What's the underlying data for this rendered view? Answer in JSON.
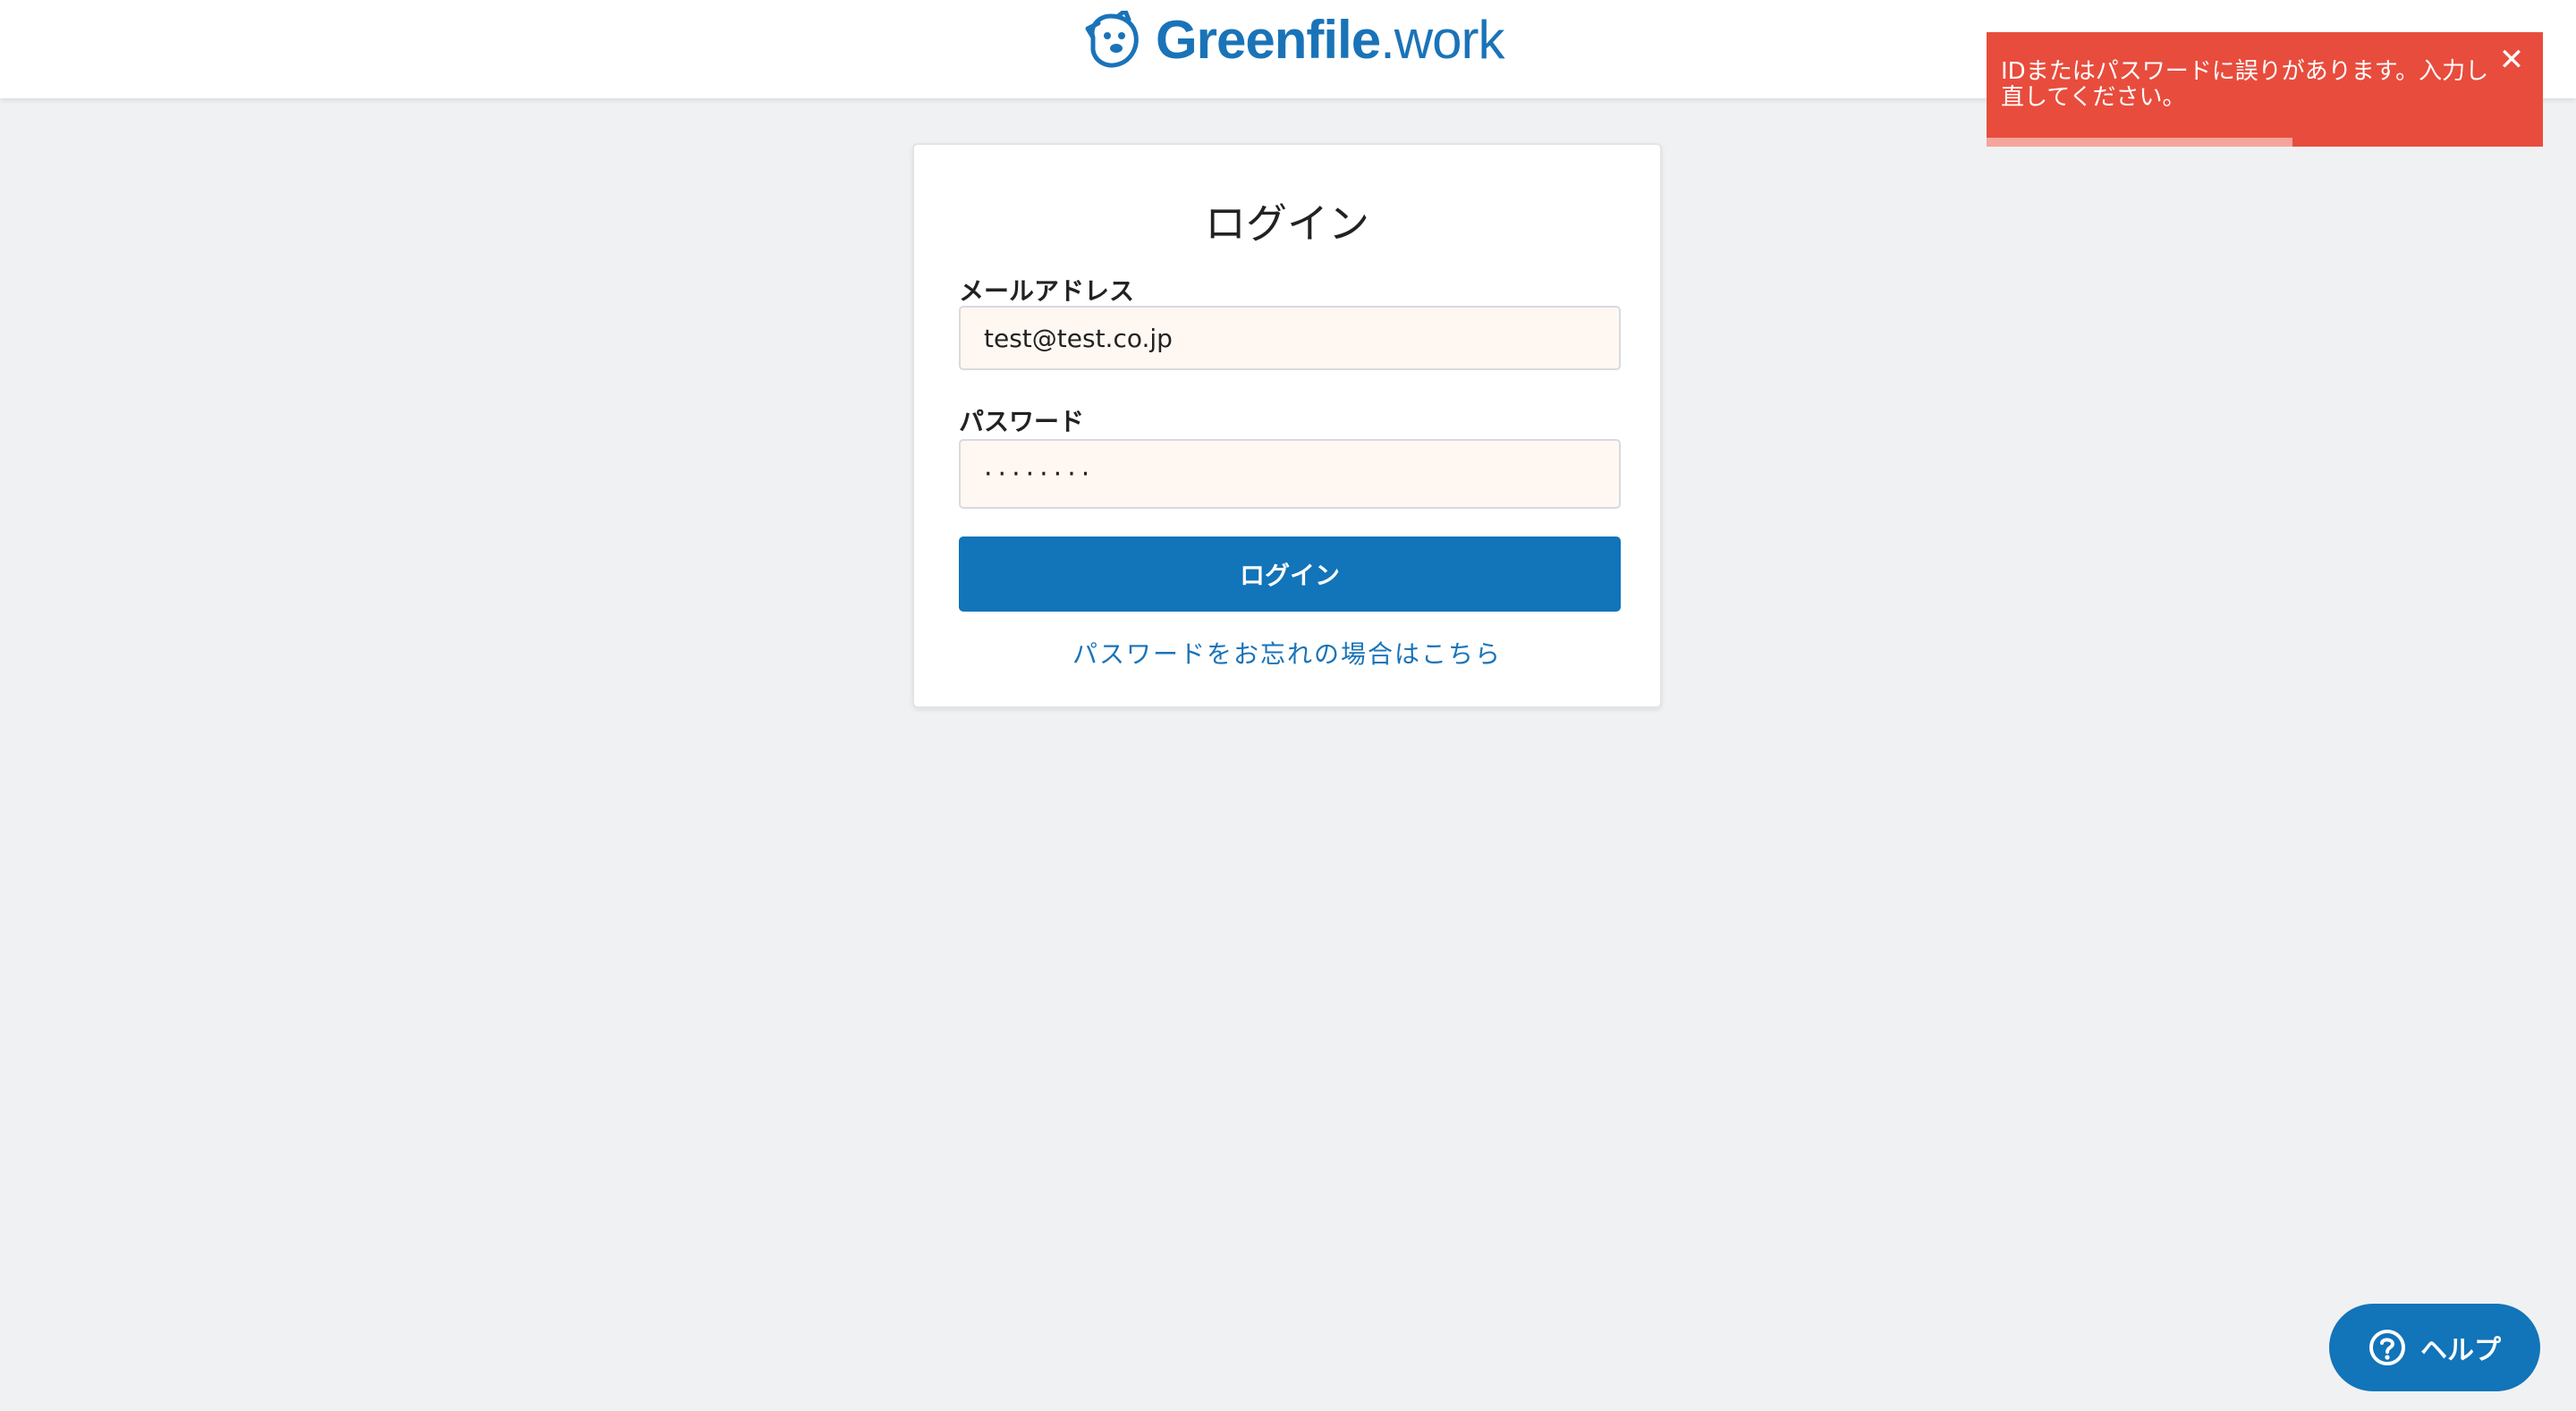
{
  "header": {
    "logo_brand": "Greenfile",
    "logo_tld": ".work",
    "brand_color": "#1a73b8",
    "logo_icon": "dog-face-icon"
  },
  "login": {
    "title": "ログイン",
    "email_label": "メールアドレス",
    "email_value": "test@test.co.jp",
    "password_label": "パスワード",
    "password_value": "········",
    "submit_label": "ログイン",
    "forgot_link": "パスワードをお忘れの場合はこちら",
    "button_color": "#1274b9"
  },
  "toast": {
    "message": "IDまたはパスワードに誤りがあります。入力し直してください。",
    "close_icon": "close-icon",
    "background_color": "#e84c3d",
    "progress": 0.55
  },
  "help": {
    "label": "ヘルプ",
    "icon": "question-circle-icon"
  }
}
